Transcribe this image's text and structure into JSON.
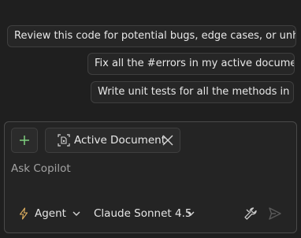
{
  "suggestions": [
    {
      "label": "Review this code for potential bugs, edge cases, or unha..."
    },
    {
      "label": "Fix all the #errors in my active document"
    },
    {
      "label": "Write unit tests for all the methods in #"
    }
  ],
  "chat_input": {
    "attachment": {
      "label": "Active Document",
      "icon": "document-reference-icon"
    },
    "placeholder": "Ask Copilot",
    "mode": {
      "label": "Agent",
      "icon": "lightning-icon"
    },
    "model": {
      "label": "Claude Sonnet 4.5"
    },
    "icons": {
      "add": "plus-icon",
      "close": "close-icon",
      "tools": "wrench-icon",
      "send": "send-icon",
      "chevron": "chevron-down-icon"
    },
    "colors": {
      "add_icon": "#7ed07e",
      "send_disabled": "#5a5a5a"
    }
  }
}
